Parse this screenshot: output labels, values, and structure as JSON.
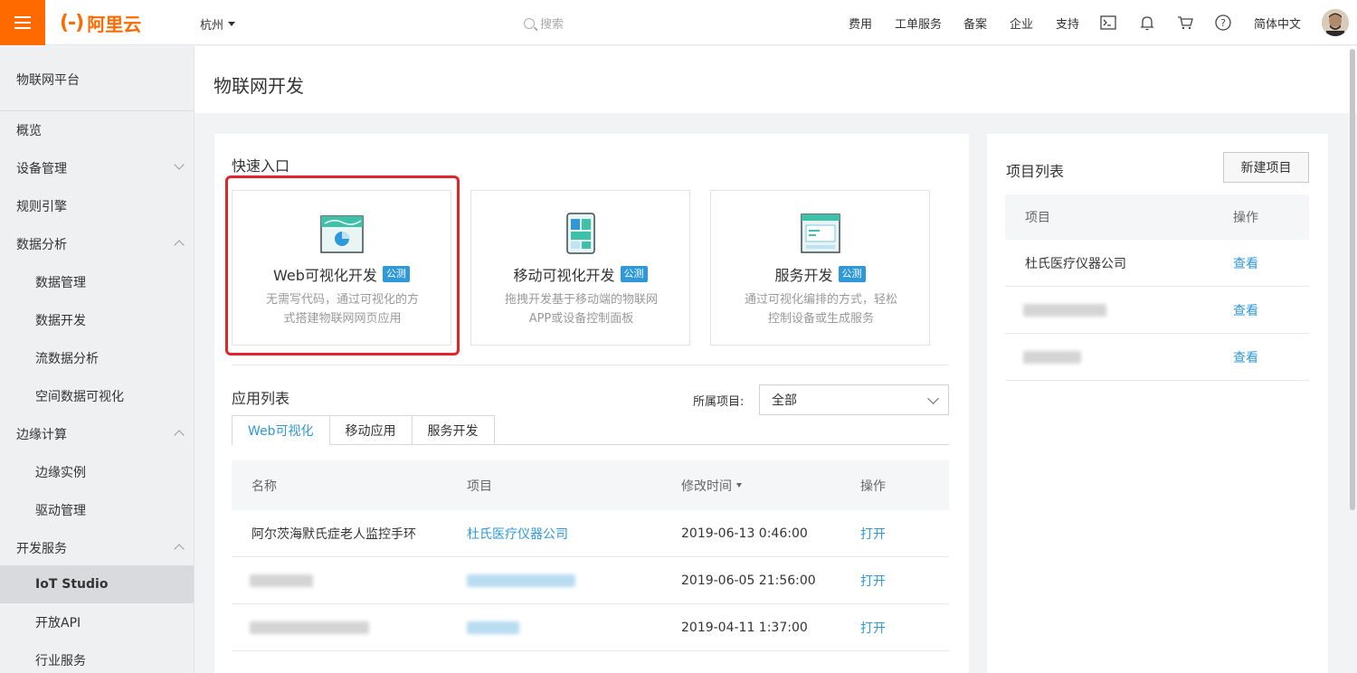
{
  "topbar": {
    "logo_mark": "(-)",
    "logo_text": "阿里云",
    "region": "杭州",
    "search_placeholder": "搜索",
    "nav": [
      "费用",
      "工单服务",
      "备案",
      "企业",
      "支持"
    ],
    "language": "简体中文"
  },
  "sidebar": {
    "title": "物联网平台",
    "items": [
      {
        "label": "概览",
        "level": 1
      },
      {
        "label": "设备管理",
        "level": 1,
        "chevron": "down"
      },
      {
        "label": "规则引擎",
        "level": 1
      },
      {
        "label": "数据分析",
        "level": 1,
        "chevron": "up"
      },
      {
        "label": "数据管理",
        "level": 2
      },
      {
        "label": "数据开发",
        "level": 2
      },
      {
        "label": "流数据分析",
        "level": 2
      },
      {
        "label": "空间数据可视化",
        "level": 2
      },
      {
        "label": "边缘计算",
        "level": 1,
        "chevron": "up"
      },
      {
        "label": "边缘实例",
        "level": 2
      },
      {
        "label": "驱动管理",
        "level": 2
      },
      {
        "label": "开发服务",
        "level": 1,
        "chevron": "up"
      },
      {
        "label": "IoT Studio",
        "level": 2,
        "active": true
      },
      {
        "label": "开放API",
        "level": 2
      },
      {
        "label": "行业服务",
        "level": 2
      }
    ]
  },
  "page": {
    "title": "物联网开发"
  },
  "quick_entry": {
    "title": "快速入口",
    "cards": [
      {
        "name": "Web可视化开发",
        "badge": "公测",
        "desc1": "无需写代码，通过可视化的方",
        "desc2": "式搭建物联网网页应用",
        "icon": "web-visual-icon"
      },
      {
        "name": "移动可视化开发",
        "badge": "公测",
        "desc1": "拖拽开发基于移动端的物联网",
        "desc2": "APP或设备控制面板",
        "icon": "mobile-visual-icon"
      },
      {
        "name": "服务开发",
        "badge": "公测",
        "desc1": "通过可视化编排的方式，轻松",
        "desc2": "控制设备或生成服务",
        "icon": "service-dev-icon"
      }
    ]
  },
  "app_list": {
    "title": "应用列表",
    "filter_label": "所属项目:",
    "filter_value": "全部",
    "tabs": [
      "Web可视化",
      "移动应用",
      "服务开发"
    ],
    "columns": [
      "名称",
      "项目",
      "修改时间",
      "操作"
    ],
    "rows": [
      {
        "name": "阿尔茨海默氏症老人监控手环",
        "project": "杜氏医疗仪器公司",
        "time": "2019-06-13 0:46:00",
        "action": "打开"
      },
      {
        "name": "",
        "project": "",
        "time": "2019-06-05 21:56:00",
        "action": "打开"
      },
      {
        "name": "",
        "project": "",
        "time": "2019-04-11 1:37:00",
        "action": "打开"
      }
    ]
  },
  "project_list": {
    "title": "项目列表",
    "new_button": "新建项目",
    "columns": [
      "项目",
      "操作"
    ],
    "rows": [
      {
        "name": "杜氏医疗仪器公司",
        "action": "查看"
      },
      {
        "name": "",
        "action": "查看"
      },
      {
        "name": "",
        "action": "查看"
      }
    ]
  },
  "colors": {
    "brand": "#ff6a00",
    "link": "#2e98d8",
    "highlight": "#e3242b"
  }
}
